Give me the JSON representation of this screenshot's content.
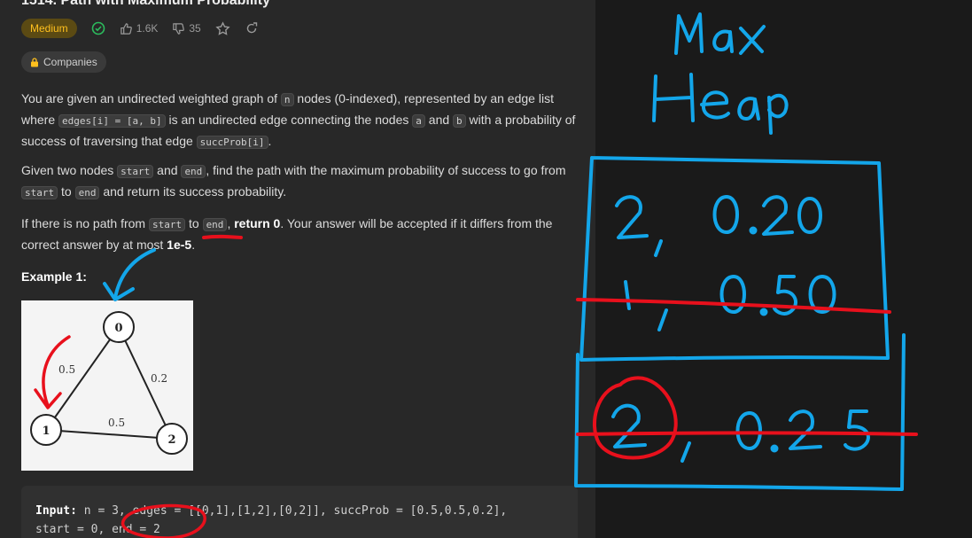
{
  "problem": {
    "title_partial": "1514. Path with Maximum Probability",
    "difficulty": "Medium",
    "likes": "1.6K",
    "dislikes": "35",
    "companies_label": "Companies"
  },
  "description": {
    "p1": [
      {
        "t": "You are given an undirected weighted graph of "
      },
      {
        "c": "n"
      },
      {
        "t": " nodes (0-indexed), represented by an edge list where "
      },
      {
        "c": "edges[i] = [a, b]"
      },
      {
        "t": " is an undirected edge connecting the nodes "
      },
      {
        "c": "a"
      },
      {
        "t": " and "
      },
      {
        "c": "b"
      },
      {
        "t": " with a probability of success of traversing that edge "
      },
      {
        "c": "succProb[i]"
      },
      {
        "t": "."
      }
    ],
    "p2": [
      {
        "t": "Given two nodes "
      },
      {
        "c": "start"
      },
      {
        "t": " and "
      },
      {
        "c": "end"
      },
      {
        "t": ", find the path with the maximum probability of success to go from "
      },
      {
        "c": "start"
      },
      {
        "t": " to "
      },
      {
        "c": "end"
      },
      {
        "t": " and return its success probability."
      }
    ],
    "p3": [
      {
        "t": "If there is no path from "
      },
      {
        "c": "start"
      },
      {
        "t": " to "
      },
      {
        "c": "end"
      },
      {
        "t": ", "
      },
      {
        "b": "return 0"
      },
      {
        "t": ". Your answer will be accepted if it differs from the correct answer by at most "
      },
      {
        "b": "1e-5"
      },
      {
        "t": "."
      }
    ]
  },
  "example": {
    "title": "Example 1:",
    "graph": {
      "nodes": [
        "0",
        "1",
        "2"
      ],
      "edge_labels": [
        "0.5",
        "0.2",
        "0.5"
      ]
    },
    "input_line1_label": "Input:",
    "input_line1_rest": " n = 3, edges = [[0,1],[1,2],[0,2]], succProb = [0.5,0.5,0.2],",
    "input_line2": "start = 0, end = 2"
  },
  "whiteboard": {
    "title_line1": "Max",
    "title_line2": "Heap",
    "rows": [
      {
        "node": "2",
        "prob": "0.20"
      },
      {
        "node": "1",
        "prob": "0.50"
      },
      {
        "node": "2",
        "prob": "0.25"
      }
    ],
    "ink_blue": "#13a6ea",
    "ink_red": "#e8101c"
  },
  "colors": {
    "panel_bg": "#282828",
    "medium_fg": "#ffc01e",
    "solved_green": "#2cbb5d"
  }
}
